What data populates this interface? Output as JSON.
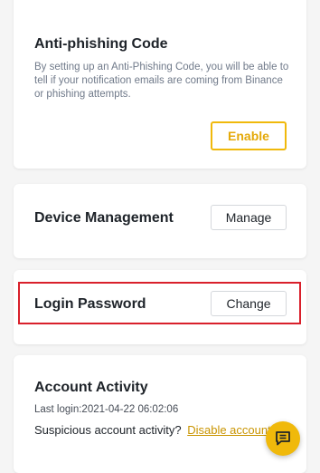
{
  "anti_phishing": {
    "title": "Anti-phishing Code",
    "description": "By setting up an Anti-Phishing Code, you will be able to tell if your notification emails are coming from Binance or phishing attempts.",
    "button_label": "Enable"
  },
  "device_management": {
    "title": "Device Management",
    "button_label": "Manage"
  },
  "login_password": {
    "title": "Login Password",
    "button_label": "Change"
  },
  "account_activity": {
    "title": "Account Activity",
    "last_login": "Last login:2021-04-22 06:02:06",
    "suspicious_label": "Suspicious account activity?",
    "disable_link": "Disable account"
  },
  "support": {
    "icon": "chat-icon"
  },
  "colors": {
    "accent": "#f0b90b",
    "highlight": "#d9202b",
    "background": "#f5f5f5"
  }
}
